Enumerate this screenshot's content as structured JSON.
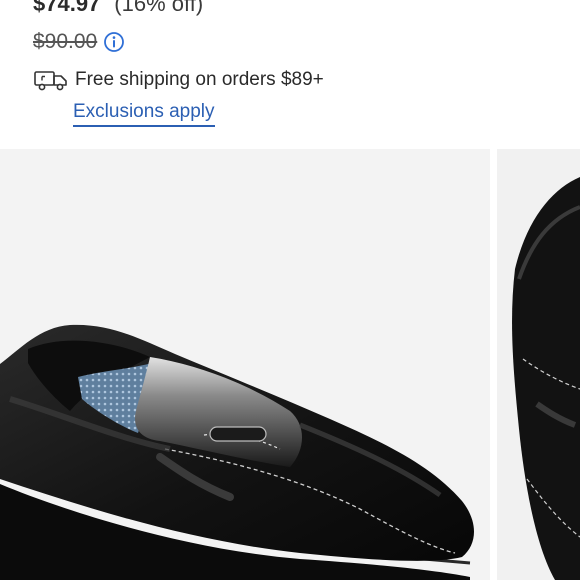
{
  "pricing": {
    "sale_price": "$74.97",
    "discount_label": "(16% off)",
    "original_price": "$90.00"
  },
  "shipping": {
    "text": "Free shipping on orders $89+",
    "exclusions_link": "Exclusions apply"
  },
  "icons": {
    "info": "info-icon",
    "shipping": "truck-icon"
  },
  "colors": {
    "link": "#2b5fb3",
    "info_icon": "#2f6fd6",
    "shoe": "#141414",
    "photo_background": "#f3f3f3"
  }
}
